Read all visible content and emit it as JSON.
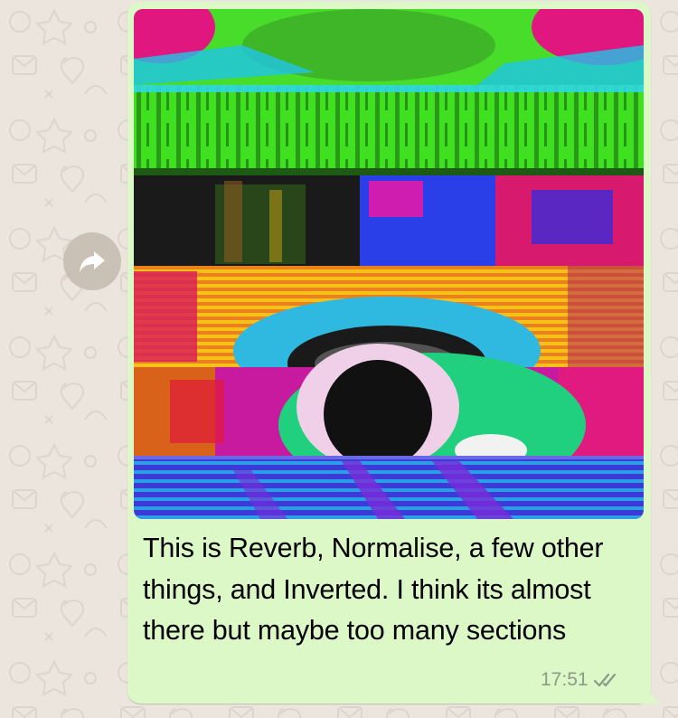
{
  "message": {
    "caption": "This is Reverb, Normalise, a few other things, and Inverted. I think its almost there but maybe too many sections",
    "time": "17:51",
    "status_icon": "double-check-icon"
  },
  "actions": {
    "forward_icon": "forward-arrow-icon"
  },
  "colors": {
    "wallpaper": "#ece5dd",
    "bubble": "#dcf8c6",
    "meta_text": "#8d9a88",
    "forward_button": "#c9c0b6"
  }
}
